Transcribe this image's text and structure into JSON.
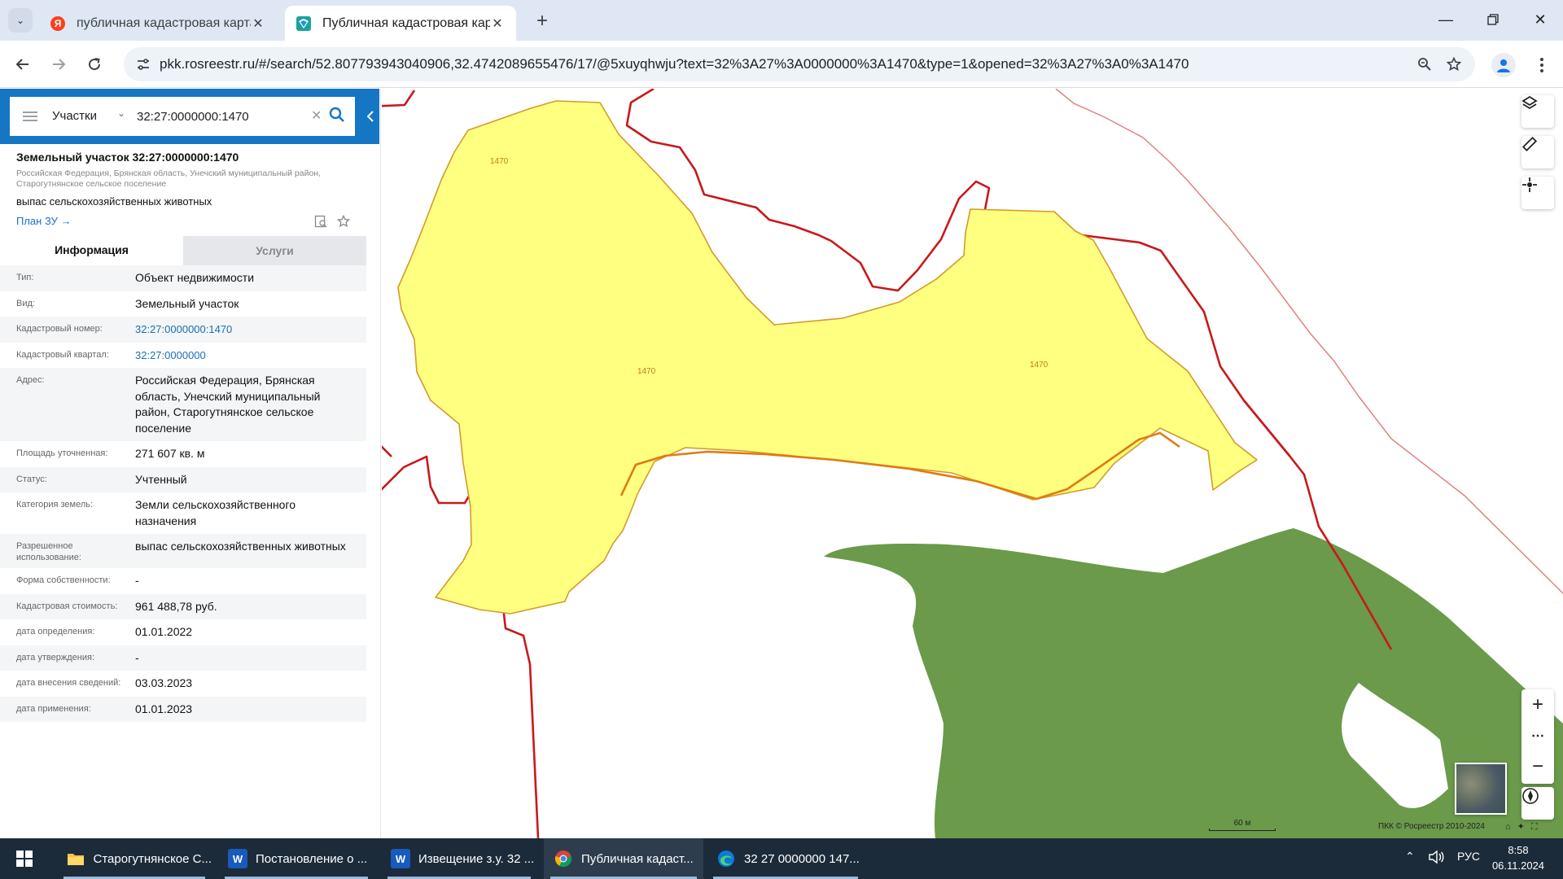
{
  "browser": {
    "tabs": [
      {
        "title": "публичная кадастровая карта",
        "favicon": "yandex-icon"
      },
      {
        "title": "Публичная кадастровая карта",
        "favicon": "rosreestr-icon"
      }
    ],
    "url": "pkk.rosreestr.ru/#/search/52.807793943040906,32.4742089655476/17/@5xuyqhwju?text=32%3A27%3A0000000%3A1470&type=1&opened=32%3A27%3A0%3A1470"
  },
  "search": {
    "type_label": "Участки",
    "query": "32:27:0000000:1470"
  },
  "object": {
    "title": "Земельный участок 32:27:0000000:1470",
    "address_short": "Российская Федерация, Брянская область, Унечский муниципальный район, Старогутнянское сельское поселение",
    "use": "выпас сельскохозяйственных животных",
    "plan_link": "План ЗУ →"
  },
  "panel_tabs": {
    "info": "Информация",
    "services": "Услуги"
  },
  "info_rows": [
    {
      "label": "Тип:",
      "value": "Объект недвижимости",
      "link": false
    },
    {
      "label": "Вид:",
      "value": "Земельный участок",
      "link": false
    },
    {
      "label": "Кадастровый номер:",
      "value": "32:27:0000000:1470",
      "link": true
    },
    {
      "label": "Кадастровый квартал:",
      "value": "32:27:0000000",
      "link": true
    },
    {
      "label": "Адрес:",
      "value": "Российская Федерация, Брянская область, Унечский муниципальный район, Старогутнянское сельское поселение",
      "link": false
    },
    {
      "label": "Площадь уточненная:",
      "value": "271 607 кв. м",
      "link": false
    },
    {
      "label": "Статус:",
      "value": "Учтенный",
      "link": false
    },
    {
      "label": "Категория земель:",
      "value": "Земли сельскохозяйственного назначения",
      "link": false
    },
    {
      "label": "Разрешенное использование:",
      "value": "выпас сельскохозяйственных животных",
      "link": false
    },
    {
      "label": "Форма собственности:",
      "value": "-",
      "link": false
    },
    {
      "label": "Кадастровая стоимость:",
      "value": "961 488,78 руб.",
      "link": false
    },
    {
      "label": "дата определения:",
      "value": "01.01.2022",
      "link": false
    },
    {
      "label": "дата утверждения:",
      "value": "-",
      "link": false
    },
    {
      "label": "дата внесения сведений:",
      "value": "03.03.2023",
      "link": false
    },
    {
      "label": "дата применения:",
      "value": "01.01.2023",
      "link": false
    }
  ],
  "map": {
    "parcel_labels": [
      "1470",
      "1470",
      "1470"
    ],
    "scale_label": "60 м",
    "copyright": "ПКК © Росреестр 2010-2024",
    "colors": {
      "parcel_fill": "#ffff80",
      "parcel_stroke": "#d59a2a",
      "boundary": "#c8191b",
      "forest": "#6a9a4a"
    }
  },
  "taskbar": {
    "items": [
      {
        "label": "Старогутнянское С...",
        "icon": "folder-icon"
      },
      {
        "label": "Постановление о ...",
        "icon": "word-icon"
      },
      {
        "label": "Извещение з.у. 32 ...",
        "icon": "word-icon"
      },
      {
        "label": "Публичная кадаст...",
        "icon": "chrome-icon"
      },
      {
        "label": "32 27 0000000 147...",
        "icon": "edge-icon"
      }
    ],
    "lang": "РУС",
    "time": "8:58",
    "date": "06.11.2024"
  }
}
